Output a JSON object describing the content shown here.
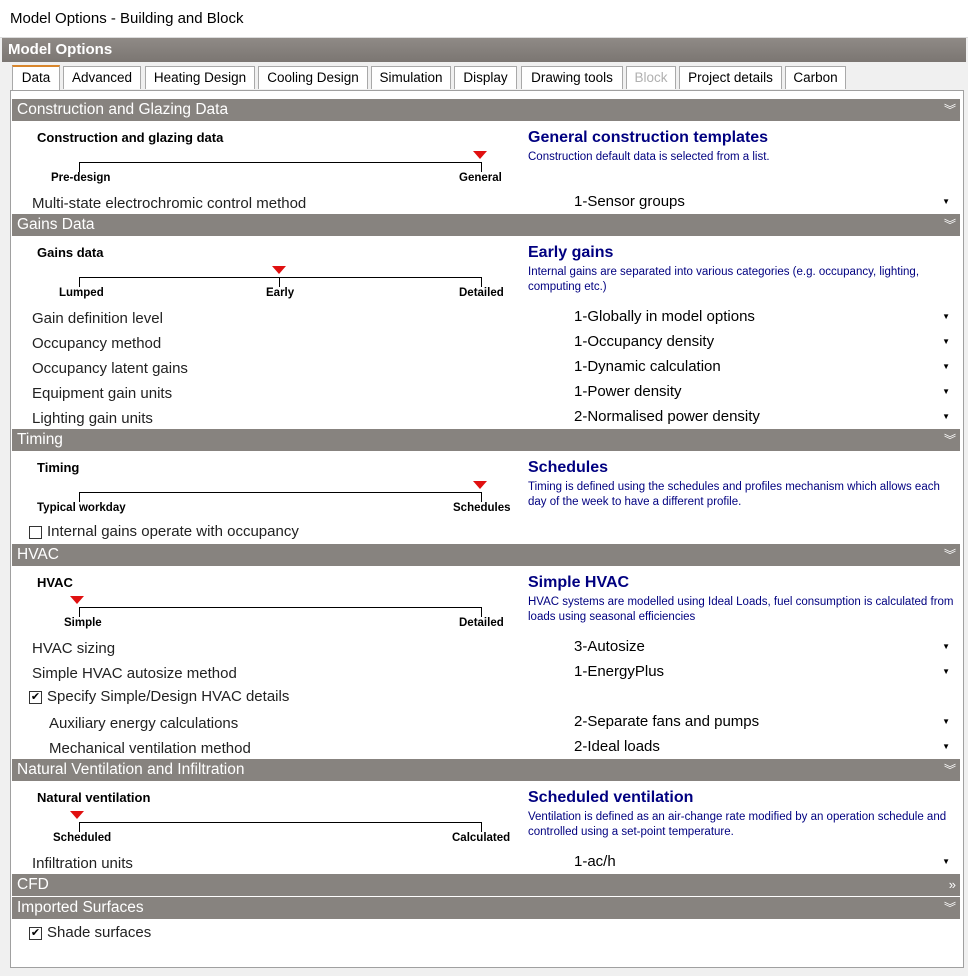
{
  "window": {
    "title": "Model Options - Building and Block"
  },
  "header": {
    "title": "Model Options"
  },
  "tabs": [
    {
      "label": "Data",
      "active": true
    },
    {
      "label": "Advanced"
    },
    {
      "label": "Heating Design"
    },
    {
      "label": "Cooling Design"
    },
    {
      "label": "Simulation"
    },
    {
      "label": "Display"
    },
    {
      "label": "Drawing tools"
    },
    {
      "label": "Block",
      "disabled": true
    },
    {
      "label": "Project details"
    },
    {
      "label": "Carbon"
    }
  ],
  "construction": {
    "header": "Construction and Glazing Data",
    "slider_title": "Construction and glazing data",
    "ticks": [
      "Pre-design",
      "General"
    ],
    "selected": "General",
    "info_title": "General construction templates",
    "info_desc": "Construction default data is selected from a list.",
    "fields": [
      {
        "label": "Multi-state electrochromic control method",
        "value": "1-Sensor groups"
      }
    ]
  },
  "gains": {
    "header": "Gains Data",
    "slider_title": "Gains data",
    "ticks": [
      "Lumped",
      "Early",
      "Detailed"
    ],
    "selected": "Early",
    "info_title": "Early gains",
    "info_desc": "Internal gains are separated into various categories (e.g. occupancy, lighting, computing etc.)",
    "fields": [
      {
        "label": "Gain definition level",
        "value": "1-Globally in model options"
      },
      {
        "label": "Occupancy method",
        "value": "1-Occupancy density"
      },
      {
        "label": "Occupancy latent gains",
        "value": "1-Dynamic calculation"
      },
      {
        "label": "Equipment gain units",
        "value": "1-Power density"
      },
      {
        "label": "Lighting gain units",
        "value": "2-Normalised power density"
      }
    ]
  },
  "timing": {
    "header": "Timing",
    "slider_title": "Timing",
    "ticks": [
      "Typical workday",
      "Schedules"
    ],
    "selected": "Schedules",
    "info_title": "Schedules",
    "info_desc": "Timing is defined using the schedules and profiles mechanism which allows each day of the week to have a different profile.",
    "checkbox": {
      "label": "Internal gains operate with occupancy",
      "checked": false
    }
  },
  "hvac": {
    "header": "HVAC",
    "slider_title": "HVAC",
    "ticks": [
      "Simple",
      "Detailed"
    ],
    "selected": "Simple",
    "info_title": "Simple HVAC",
    "info_desc": "HVAC systems are modelled using Ideal Loads, fuel consumption is calculated from loads using seasonal efficiencies",
    "fields": [
      {
        "label": "HVAC sizing",
        "value": "3-Autosize"
      },
      {
        "label": "Simple HVAC autosize method",
        "value": "1-EnergyPlus"
      }
    ],
    "checkbox": {
      "label": "Specify Simple/Design HVAC details",
      "checked": true
    },
    "subfields": [
      {
        "label": "Auxiliary energy calculations",
        "value": "2-Separate fans and pumps"
      },
      {
        "label": "Mechanical ventilation method",
        "value": "2-Ideal loads"
      }
    ]
  },
  "natvent": {
    "header": "Natural Ventilation and Infiltration",
    "slider_title": "Natural ventilation",
    "ticks": [
      "Scheduled",
      "Calculated"
    ],
    "selected": "Scheduled",
    "info_title": "Scheduled ventilation",
    "info_desc": "Ventilation is defined as an air-change rate modified by an operation schedule and controlled using a set-point temperature.",
    "fields": [
      {
        "label": "Infiltration units",
        "value": "1-ac/h"
      }
    ]
  },
  "cfd": {
    "header": "CFD"
  },
  "imported": {
    "header": "Imported Surfaces",
    "checkbox": {
      "label": "Shade surfaces",
      "checked": true
    }
  },
  "icons": {
    "collapse": "double-chevron-down-icon",
    "expand": "double-chevron-right-icon",
    "dropdown": "caret-down-icon",
    "marker": "red-triangle-marker-icon"
  },
  "colors": {
    "section_header": "#87837f",
    "info_text": "#000080",
    "marker": "#e01010",
    "active_tab_accent": "#d8862c"
  }
}
